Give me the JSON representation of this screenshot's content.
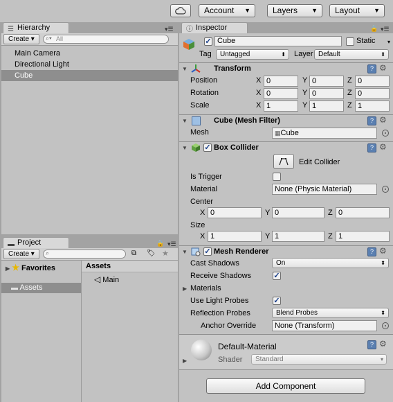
{
  "toolbar": {
    "cloud_icon": "cloud-icon",
    "account": "Account",
    "layers": "Layers",
    "layout": "Layout"
  },
  "hierarchy": {
    "tab": "Hierarchy",
    "create": "Create",
    "search_placeholder": "All",
    "items": [
      "Main Camera",
      "Directional Light",
      "Cube"
    ],
    "selected": "Cube"
  },
  "project": {
    "tab": "Project",
    "create": "Create",
    "favorites": "Favorites",
    "assets_tree": "Assets",
    "assets_header": "Assets",
    "asset_item": "Main"
  },
  "inspector": {
    "tab": "Inspector",
    "object_name": "Cube",
    "static_label": "Static",
    "tag_label": "Tag",
    "tag_value": "Untagged",
    "layer_label": "Layer",
    "layer_value": "Default",
    "transform": {
      "title": "Transform",
      "position_label": "Position",
      "rotation_label": "Rotation",
      "scale_label": "Scale",
      "x": "X",
      "y": "Y",
      "z": "Z",
      "position": [
        "0",
        "0",
        "0"
      ],
      "rotation": [
        "0",
        "0",
        "0"
      ],
      "scale": [
        "1",
        "1",
        "1"
      ]
    },
    "mesh_filter": {
      "title": "Cube (Mesh Filter)",
      "mesh_label": "Mesh",
      "mesh_value": "Cube"
    },
    "box_collider": {
      "title": "Box Collider",
      "edit_collider": "Edit Collider",
      "is_trigger_label": "Is Trigger",
      "material_label": "Material",
      "material_value": "None (Physic Material)",
      "center_label": "Center",
      "size_label": "Size",
      "x": "X",
      "y": "Y",
      "z": "Z",
      "center": [
        "0",
        "0",
        "0"
      ],
      "size": [
        "1",
        "1",
        "1"
      ]
    },
    "mesh_renderer": {
      "title": "Mesh Renderer",
      "cast_shadows_label": "Cast Shadows",
      "cast_shadows_value": "On",
      "receive_shadows_label": "Receive Shadows",
      "materials_label": "Materials",
      "use_light_probes_label": "Use Light Probes",
      "reflection_probes_label": "Reflection Probes",
      "reflection_probes_value": "Blend Probes",
      "anchor_override_label": "Anchor Override",
      "anchor_override_value": "None (Transform)"
    },
    "material": {
      "name": "Default-Material",
      "shader_label": "Shader",
      "shader_value": "Standard"
    },
    "add_component": "Add Component"
  }
}
